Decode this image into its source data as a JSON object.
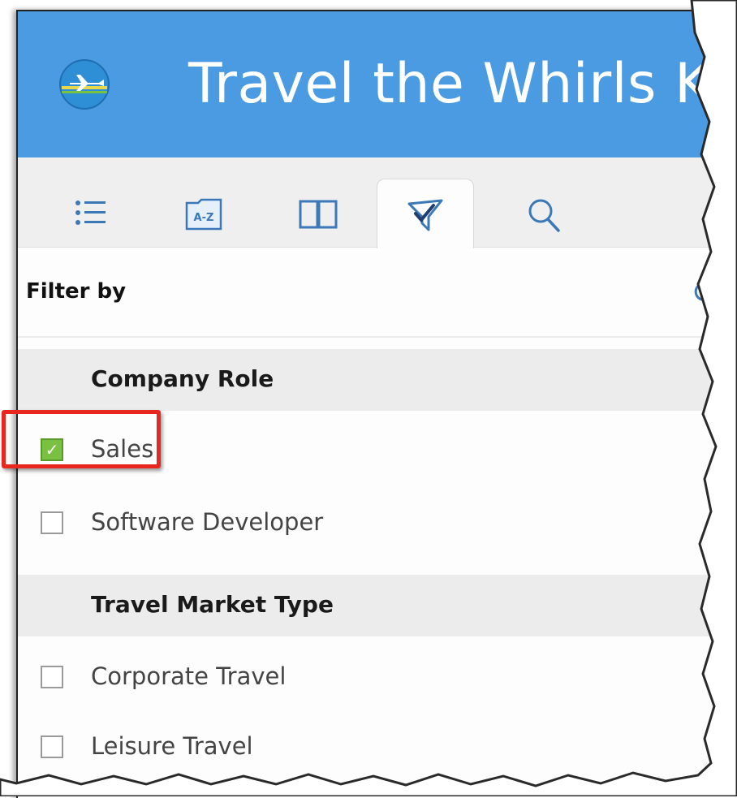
{
  "header": {
    "title": "Travel the Whirls Kr",
    "logo_icon": "plane-globe-icon",
    "background_color": "#4b9be3"
  },
  "toolbar": {
    "tabs": [
      {
        "icon": "list-icon",
        "active": false
      },
      {
        "icon": "a-z-index-icon",
        "label": "A-Z",
        "active": false
      },
      {
        "icon": "book-icon",
        "active": false
      },
      {
        "icon": "filter-icon",
        "active": true
      },
      {
        "icon": "search-icon",
        "active": false
      }
    ]
  },
  "filter": {
    "title": "Filter by",
    "groups": [
      {
        "label": "Company Role",
        "options": [
          {
            "label": "Sales",
            "checked": true
          },
          {
            "label": "Software Developer",
            "checked": false
          }
        ]
      },
      {
        "label": "Travel Market Type",
        "options": [
          {
            "label": "Corporate Travel",
            "checked": false
          },
          {
            "label": "Leisure Travel",
            "checked": false
          }
        ]
      }
    ]
  },
  "colors": {
    "checkbox_checked": "#7ac142",
    "highlight_box": "#e8281e"
  }
}
